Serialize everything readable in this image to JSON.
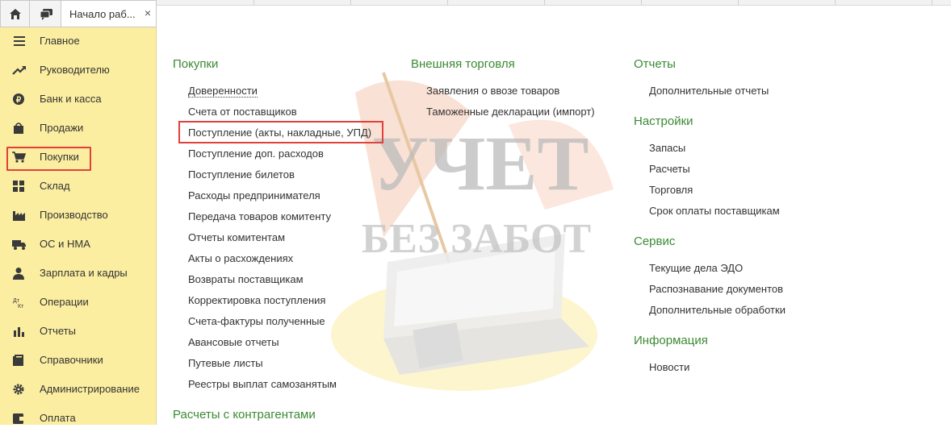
{
  "tab": {
    "title": "Начало раб...",
    "close": "×"
  },
  "sidebar": {
    "items": [
      {
        "label": "Главное",
        "icon": "menu-icon"
      },
      {
        "label": "Руководителю",
        "icon": "trend-icon"
      },
      {
        "label": "Банк и касса",
        "icon": "coin-icon"
      },
      {
        "label": "Продажи",
        "icon": "bag-icon"
      },
      {
        "label": "Покупки",
        "icon": "cart-icon"
      },
      {
        "label": "Склад",
        "icon": "grid-icon"
      },
      {
        "label": "Производство",
        "icon": "factory-icon"
      },
      {
        "label": "ОС и НМА",
        "icon": "truck-icon"
      },
      {
        "label": "Зарплата и кадры",
        "icon": "person-icon"
      },
      {
        "label": "Операции",
        "icon": "dt-kt-icon"
      },
      {
        "label": "Отчеты",
        "icon": "bar-chart-icon"
      },
      {
        "label": "Справочники",
        "icon": "book-icon"
      },
      {
        "label": "Администрирование",
        "icon": "gear-icon"
      },
      {
        "label": "Оплата",
        "icon": "wallet-icon"
      }
    ],
    "active": "Покупки"
  },
  "columns": {
    "purchases": {
      "title": "Покупки",
      "links": [
        "Доверенности",
        "Счета от поставщиков",
        "Поступление (акты, накладные, УПД)",
        "Поступление доп. расходов",
        "Поступление билетов",
        "Расходы предпринимателя",
        "Передача товаров комитенту",
        "Отчеты комитентам",
        "Акты о расхождениях",
        "Возвраты поставщикам",
        "Корректировка поступления",
        "Счета-фактуры полученные",
        "Авансовые отчеты",
        "Путевые листы",
        "Реестры выплат самозанятым"
      ]
    },
    "settlements": {
      "title": "Расчеты с контрагентами"
    },
    "foreign_trade": {
      "title": "Внешняя торговля",
      "links": [
        "Заявления о ввозе товаров",
        "Таможенные декларации (импорт)"
      ]
    },
    "reports": {
      "title": "Отчеты",
      "links": [
        "Дополнительные отчеты"
      ]
    },
    "settings": {
      "title": "Настройки",
      "links": [
        "Запасы",
        "Расчеты",
        "Торговля",
        "Срок оплаты поставщикам"
      ]
    },
    "service": {
      "title": "Сервис",
      "links": [
        "Текущие дела ЭДО",
        "Распознавание документов",
        "Дополнительные обработки"
      ]
    },
    "info": {
      "title": "Информация",
      "links": [
        "Новости"
      ]
    }
  },
  "watermark": {
    "line1": "УЧЕТ",
    "line2": "БЕЗ ЗАБОТ"
  },
  "colors": {
    "sidebar_bg": "#fbeea0",
    "section_title": "#3b8a34",
    "highlight": "#e2403a"
  }
}
